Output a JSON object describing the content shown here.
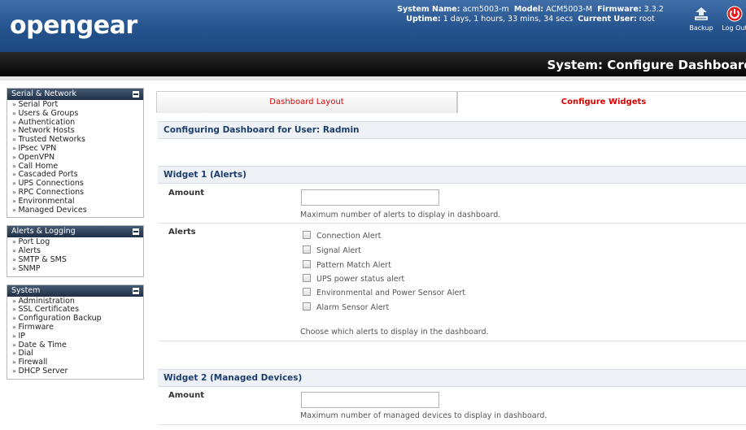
{
  "header": {
    "logo": "opengear",
    "system_name_label": "System Name:",
    "system_name": "acm5003-m",
    "model_label": "Model:",
    "model": "ACM5003-M",
    "firmware_label": "Firmware:",
    "firmware": "3.3.2",
    "uptime_label": "Uptime:",
    "uptime": "1 days, 1 hours, 33 mins, 34 secs",
    "current_user_label": "Current User:",
    "current_user": "root",
    "backup_label": "Backup",
    "logout_label": "Log Out"
  },
  "page_title": "System: Configure Dashboard",
  "sidebar": {
    "serial_network": {
      "title": "Serial & Network",
      "items": [
        "Serial Port",
        "Users & Groups",
        "Authentication",
        "Network Hosts",
        "Trusted Networks",
        "IPsec VPN",
        "OpenVPN",
        "Call Home",
        "Cascaded Ports",
        "UPS Connections",
        "RPC Connections",
        "Environmental",
        "Managed Devices"
      ]
    },
    "alerts_logging": {
      "title": "Alerts & Logging",
      "items": [
        "Port Log",
        "Alerts",
        "SMTP & SMS",
        "SNMP"
      ]
    },
    "system": {
      "title": "System",
      "items": [
        "Administration",
        "SSL Certificates",
        "Configuration Backup",
        "Firmware",
        "IP",
        "Date & Time",
        "Dial",
        "Firewall",
        "DHCP Server"
      ]
    }
  },
  "tabs": {
    "layout": "Dashboard Layout",
    "widgets": "Configure Widgets"
  },
  "main": {
    "user_heading": "Configuring Dashboard for User: Radmin",
    "widget1": {
      "title": "Widget 1 (Alerts)",
      "amount_label": "Amount",
      "amount_value": "",
      "amount_hint": "Maximum number of alerts to display in dashboard.",
      "alerts_label": "Alerts",
      "alert_options": [
        "Connection Alert",
        "Signal Alert",
        "Pattern Match Alert",
        "UPS power status alert",
        "Environmental and Power Sensor Alert",
        "Alarm Sensor Alert"
      ],
      "alerts_hint": "Choose which alerts to display in the dashboard."
    },
    "widget2": {
      "title": "Widget 2 (Managed Devices)",
      "amount_label": "Amount",
      "amount_value": "",
      "amount_hint": "Maximum number of managed devices to display in dashboard."
    }
  },
  "colors": {
    "header_blue": "#25538d",
    "tab_red": "#dd0000",
    "section_text": "#1d3d6c"
  }
}
